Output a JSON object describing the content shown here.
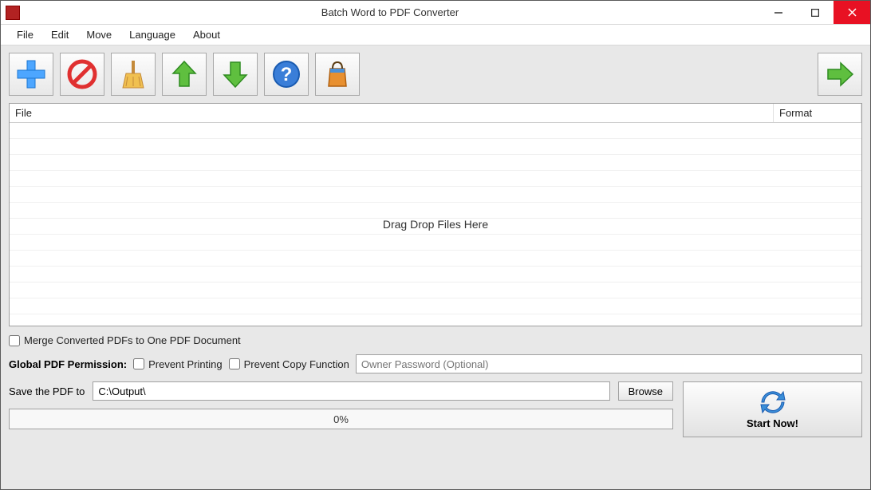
{
  "window": {
    "title": "Batch Word to PDF Converter"
  },
  "menu": {
    "file": "File",
    "edit": "Edit",
    "move": "Move",
    "language": "Language",
    "about": "About"
  },
  "toolbar": {
    "add": "add",
    "remove": "remove",
    "clear": "clear",
    "up": "up",
    "down": "down",
    "help": "help",
    "shop": "shop",
    "go": "go"
  },
  "list": {
    "col_file": "File",
    "col_format": "Format",
    "drop_msg": "Drag  Drop Files Here"
  },
  "options": {
    "merge_label": "Merge Converted PDFs to One PDF Document",
    "perm_label": "Global PDF Permission:",
    "prevent_print": "Prevent Printing",
    "prevent_copy": "Prevent Copy Function",
    "owner_pw_placeholder": "Owner Password (Optional)"
  },
  "save": {
    "label": "Save the PDF to",
    "path": "C:\\Output\\",
    "browse": "Browse"
  },
  "progress": {
    "text": "0%"
  },
  "start": {
    "label": "Start Now!"
  }
}
